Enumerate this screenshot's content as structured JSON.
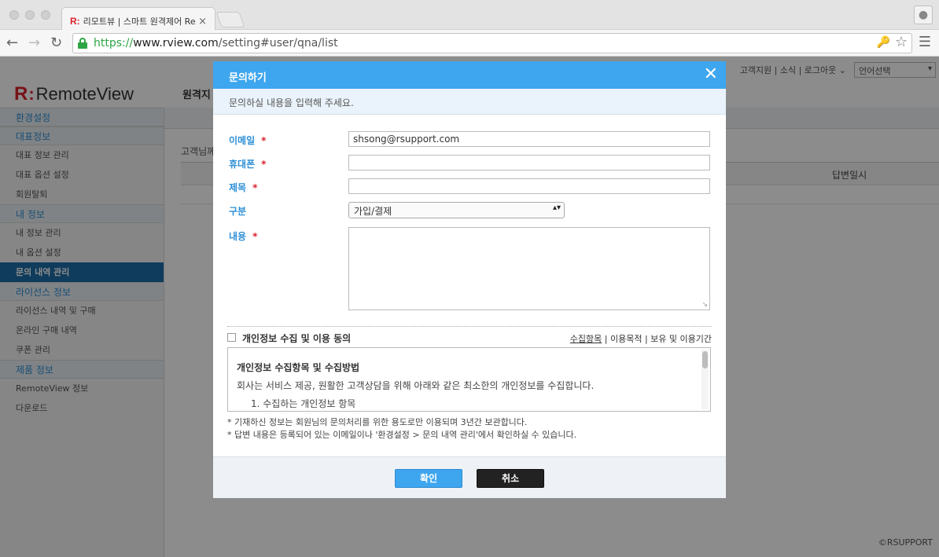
{
  "browser": {
    "tab_favicon": "R:",
    "tab_title": "리모트뷰 | 스마트 원격제어 Rem",
    "tab_close": "×",
    "url_https": "https://",
    "url_host": "www.rview.com",
    "url_path": "/setting#user/qna/list"
  },
  "site": {
    "logo_r": "R",
    "logo_colon": ":",
    "logo_text": "RemoteView",
    "topnav": "고객지원 | 소식 | 로그아웃 ⌄",
    "lang_select": "언어선택",
    "main_tab": "원격지",
    "content_text": "고객님께",
    "table_col_answer_date": "답변일시",
    "copyright": "©RSUPPORT"
  },
  "sidebar": {
    "sections": [
      {
        "title": "환경설정",
        "items": []
      },
      {
        "title": "대표정보",
        "items": [
          "대표 정보 관리",
          "대표 옵션 설정",
          "회원탈퇴"
        ]
      },
      {
        "title": "내 정보",
        "items": [
          "내 정보 관리",
          "내 옵션 설정",
          "문의 내역 관리"
        ]
      },
      {
        "title": "라이선스 정보",
        "items": [
          "라이선스 내역 및 구매",
          "온라인 구매 내역",
          "쿠폰 관리"
        ]
      },
      {
        "title": "제품 정보",
        "items": [
          "RemoteView 정보",
          "다운로드"
        ]
      }
    ],
    "active_item": "문의 내역 관리"
  },
  "modal": {
    "title": "문의하기",
    "close": "✕",
    "subtitle": "문의하실 내용을 입력해 주세요.",
    "fields": {
      "email_label": "이메일",
      "email_value": "shsong@rsupport.com",
      "phone_label": "휴대폰",
      "phone_value": "",
      "subject_label": "제목",
      "subject_value": "",
      "category_label": "구분",
      "category_value": "가입/결제",
      "content_label": "내용",
      "required_mark": "*"
    },
    "consent": {
      "label": "개인정보 수집 및 이용 동의",
      "link_items": "수집항목",
      "link_purpose": "| 이용목적 |",
      "link_retention": "보유 및 이용기간",
      "checked": false
    },
    "privacy": {
      "title": "개인정보 수집항목 및 수집방법",
      "text": "회사는 서비스 제공, 원활한 고객상담을 위해 아래와 같은 최소한의 개인정보를 수집합니다.",
      "item1": "1. 수집하는 개인정보 항목"
    },
    "notes": [
      "* 기재하신 정보는 회원님의 문의처리를 위한 용도로만 이용되며 3년간 보관합니다.",
      "* 답변 내용은 등록되어 있는 이메일이나 '환경설정 > 문의 내역 관리'에서 확인하실 수 있습니다."
    ],
    "buttons": {
      "ok": "확인",
      "cancel": "취소"
    }
  },
  "colors": {
    "accent": "#3ea6ee",
    "required": "#d9232d",
    "sidebar_active": "#1d6ea8"
  }
}
